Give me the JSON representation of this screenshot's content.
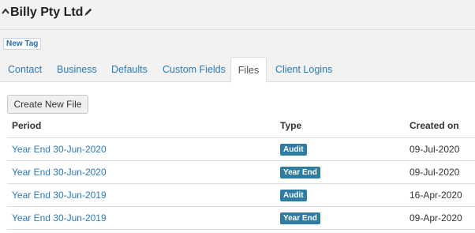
{
  "header": {
    "company_name": "Billy Pty Ltd",
    "collapse_icon": "caret-up-icon",
    "edit_icon": "pencil-icon"
  },
  "tags": {
    "new_tag_label": "New Tag"
  },
  "tabs": [
    {
      "label": "Contact",
      "active": false
    },
    {
      "label": "Business",
      "active": false
    },
    {
      "label": "Defaults",
      "active": false
    },
    {
      "label": "Custom Fields",
      "active": false
    },
    {
      "label": "Files",
      "active": true
    },
    {
      "label": "Client Logins",
      "active": false
    }
  ],
  "toolbar": {
    "create_label": "Create New File"
  },
  "table": {
    "headers": {
      "period": "Period",
      "type": "Type",
      "created": "Created on"
    },
    "rows": [
      {
        "period": "Year End 30-Jun-2020",
        "type": "Audit",
        "created": "09-Jul-2020"
      },
      {
        "period": "Year End 30-Jun-2020",
        "type": "Year End",
        "created": "09-Jul-2020"
      },
      {
        "period": "Year End 30-Jun-2019",
        "type": "Audit",
        "created": "16-Apr-2020"
      },
      {
        "period": "Year End 30-Jun-2019",
        "type": "Year End",
        "created": "09-Apr-2020"
      }
    ]
  },
  "colors": {
    "link": "#2a7ab8",
    "badge": "#2f7ca3",
    "header_bg": "#f2f2f2"
  }
}
